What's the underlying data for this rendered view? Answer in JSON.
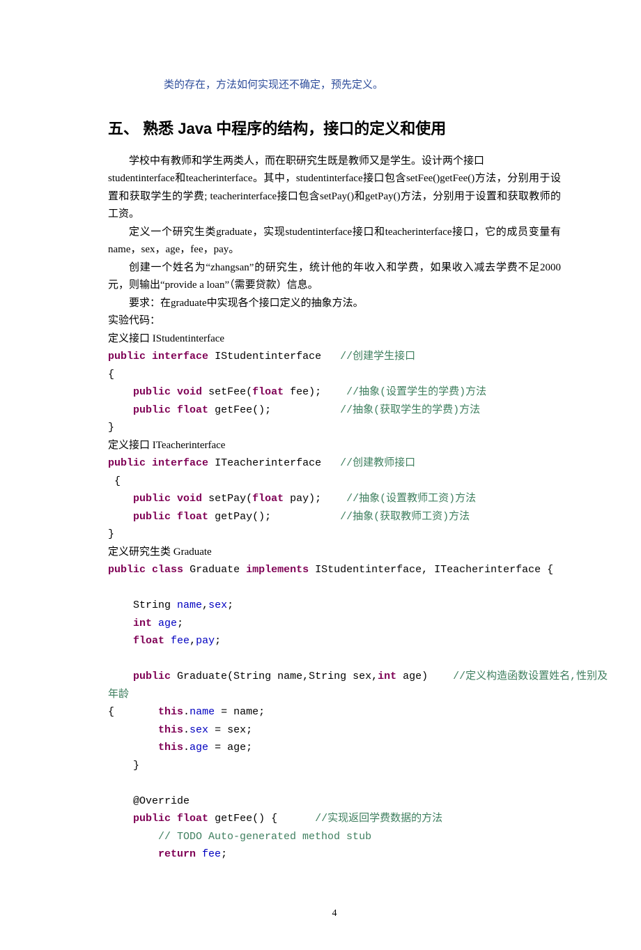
{
  "topNote": "类的存在，方法如何实现还不确定，预先定义。",
  "heading": "五、 熟悉 Java 中程序的结构，接口的定义和使用",
  "para1_a": "学校中有教师和学生两类人，而在职研究生既是教师又是学生。设计两个接口",
  "para1_b": "studentinterface和teacherinterface。其中，studentinterface接口包含setFee()getFee()方法，分别用于设置和获取学生的学费; teacherinterface接口包含setPay()和getPay()方法，分别用于设置和获取教师的工资。",
  "para2": "定义一个研究生类graduate，实现studentinterface接口和teacherinterface接口，它的成员变量有name，sex，age，fee，pay。",
  "para3": "创建一个姓名为“zhangsan”的研究生，统计他的年收入和学费，如果收入减去学费不足2000元，则输出“provide a loan”（需要贷款）信息。",
  "para4": "要求：在graduate中实现各个接口定义的抽象方法。",
  "label_code": "实验代码：",
  "label_iface_student": "定义接口 IStudentinterface",
  "label_iface_teacher": "定义接口 ITeacherinterface",
  "label_graduate": "定义研究生类 Graduate",
  "pageNumber": "4",
  "code": {
    "s1": {
      "kw_public": "public",
      "kw_interface": "interface",
      "name": "IStudentinterface",
      "cm_head": "//创建学生接口",
      "lbrace": "{",
      "kw_void": "void",
      "m1": "setFee(",
      "kw_float": "float",
      "m1b": " fee);",
      "cm1": "//抽象(设置学生的学费)方法",
      "m2": " getFee();",
      "cm2": "//抽象(获取学生的学费)方法",
      "rbrace": "}"
    },
    "s2": {
      "name": "ITeacherinterface",
      "cm_head": "//创建教师接口",
      "lbrace": " {",
      "m1": "setPay(",
      "m1b": " pay);",
      "cm1": "//抽象(设置教师工资)方法",
      "m2": " getPay();",
      "cm2": "//抽象(获取教师工资)方法",
      "rbrace": "}"
    },
    "grad": {
      "kw_class": "class",
      "name": "Graduate",
      "kw_implements": "implements",
      "impl": "IStudentinterface, ITeacherinterface {",
      "f_string": "String ",
      "f_name": "name",
      "f_sex": "sex",
      "kw_int": "int",
      "f_age": "age",
      "f_fee": "fee",
      "f_pay": "pay",
      "ctor_sig_a": "Graduate(String name,String sex,",
      "ctor_sig_b": " age)",
      "cm_ctor": "//定义构造函数设置姓名,性别及",
      "cm_ctor2": "年龄",
      "lbrace": "{",
      "kw_this": "this",
      "a1": " = name;",
      "a2": " = sex;",
      "a3": " = age;",
      "rbrace": "}",
      "anno": "@Override",
      "getfee_sig": " getFee() {",
      "cm_getfee": "//实现返回学费数据的方法",
      "cm_todo": "// TODO Auto-generated method stub",
      "kw_return": "return",
      "ret_fee": ";"
    }
  }
}
